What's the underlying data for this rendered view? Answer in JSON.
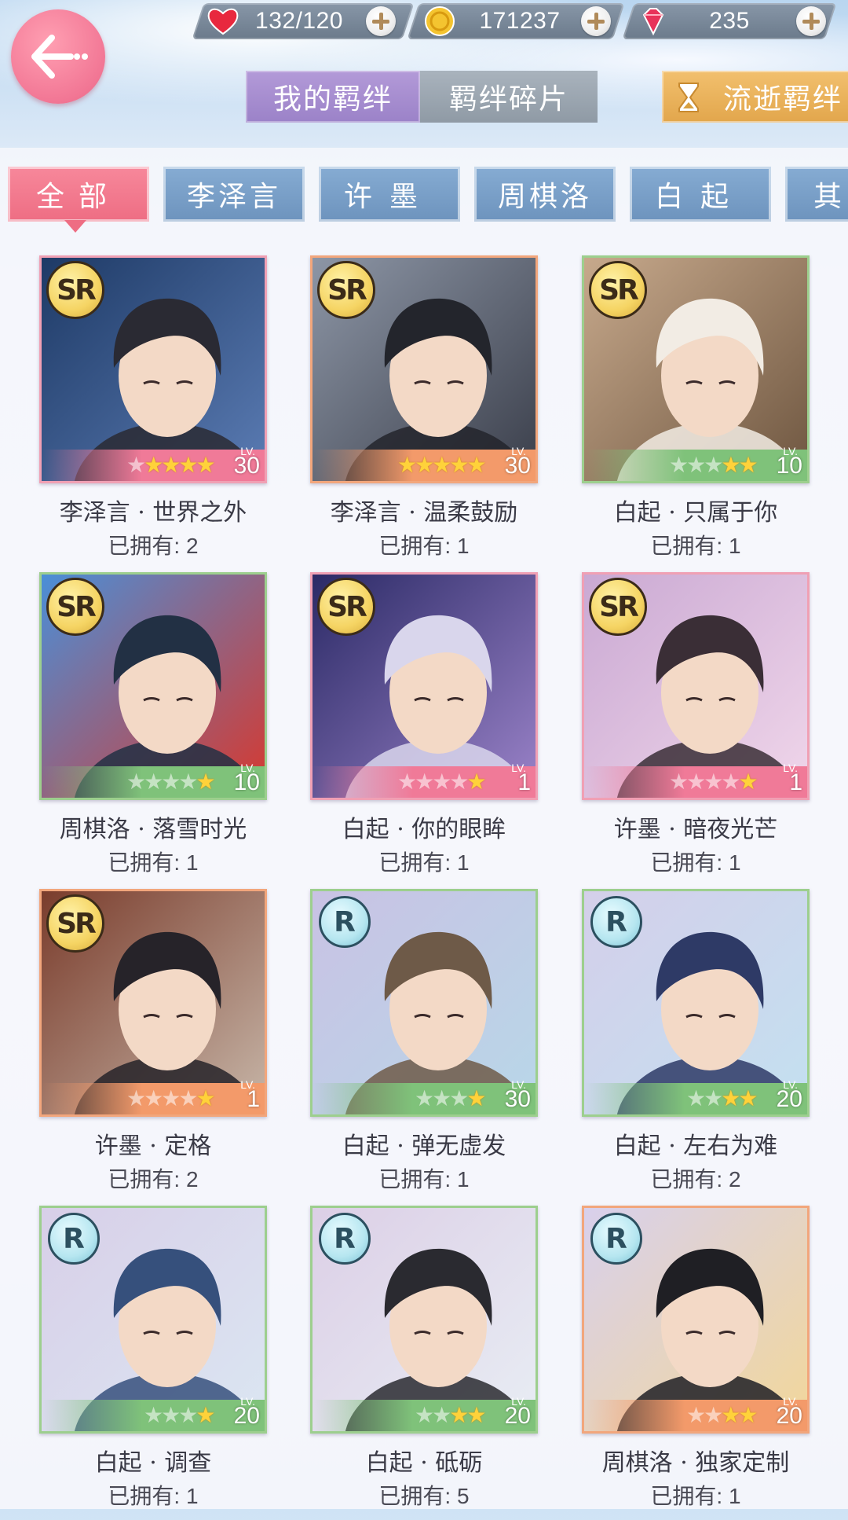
{
  "resources": {
    "stamina": {
      "icon": "heart-icon",
      "value": "132/120"
    },
    "gold": {
      "icon": "gold-coin-icon",
      "value": "171237"
    },
    "diamond": {
      "icon": "diamond-icon",
      "value": "235"
    }
  },
  "top_tabs": {
    "mine": "我的羁绊",
    "fragments": "羁绊碎片",
    "lapsed": "流逝羁绊"
  },
  "filters": [
    "全部",
    "李泽言",
    "许墨",
    "周棋洛",
    "白起",
    "其"
  ],
  "owned_label": "已拥有: ",
  "cards": [
    {
      "rarity": "SR",
      "name": "李泽言 · 世界之外",
      "owned": 2,
      "stars": 4,
      "max_stars": 5,
      "level": "30",
      "frame": "pink",
      "palette": [
        "#1e3a66",
        "#5b7cb4",
        "#2a2a33"
      ]
    },
    {
      "rarity": "SR",
      "name": "李泽言 · 温柔鼓励",
      "owned": 1,
      "stars": 5,
      "max_stars": 5,
      "level": "30",
      "frame": "orange",
      "palette": [
        "#8d96a6",
        "#3a3e4a",
        "#23252c"
      ]
    },
    {
      "rarity": "SR",
      "name": "白起 · 只属于你",
      "owned": 1,
      "stars": 2,
      "max_stars": 5,
      "level": "10",
      "frame": "green",
      "palette": [
        "#c7a98c",
        "#6e5640",
        "#f2ece4"
      ]
    },
    {
      "rarity": "SR",
      "name": "周棋洛 · 落雪时光",
      "owned": 1,
      "stars": 1,
      "max_stars": 5,
      "level": "10",
      "frame": "green",
      "palette": [
        "#4a8fd8",
        "#d8382e",
        "#223044"
      ]
    },
    {
      "rarity": "SR",
      "name": "白起 · 你的眼眸",
      "owned": 1,
      "stars": 1,
      "max_stars": 5,
      "level": "1",
      "frame": "pink",
      "palette": [
        "#2b2a66",
        "#9b83c9",
        "#d9d6ec"
      ]
    },
    {
      "rarity": "SR",
      "name": "许墨 · 暗夜光芒",
      "owned": 1,
      "stars": 1,
      "max_stars": 5,
      "level": "1",
      "frame": "pink",
      "palette": [
        "#caa9d3",
        "#f0d6ea",
        "#3a2e36"
      ]
    },
    {
      "rarity": "SR",
      "name": "许墨 · 定格",
      "owned": 2,
      "stars": 1,
      "max_stars": 5,
      "level": "1",
      "frame": "orange",
      "palette": [
        "#7a3c2c",
        "#c7b6a8",
        "#262329"
      ]
    },
    {
      "rarity": "R",
      "name": "白起 · 弹无虚发",
      "owned": 1,
      "stars": 1,
      "max_stars": 4,
      "level": "30",
      "frame": "green",
      "palette": [
        "#c9c2e4",
        "#b8d7e8",
        "#6e5a48"
      ]
    },
    {
      "rarity": "R",
      "name": "白起 · 左右为难",
      "owned": 2,
      "stars": 2,
      "max_stars": 4,
      "level": "20",
      "frame": "green",
      "palette": [
        "#d4cfea",
        "#c3e0f0",
        "#2e3a66"
      ]
    },
    {
      "rarity": "R",
      "name": "白起 · 调查",
      "owned": 1,
      "stars": 1,
      "max_stars": 4,
      "level": "20",
      "frame": "green",
      "palette": [
        "#d8cfe8",
        "#dbe6f2",
        "#36507c"
      ]
    },
    {
      "rarity": "R",
      "name": "白起 · 砥砺",
      "owned": 5,
      "stars": 2,
      "max_stars": 4,
      "level": "20",
      "frame": "green",
      "palette": [
        "#dccfe6",
        "#e8edf4",
        "#2a2a30"
      ]
    },
    {
      "rarity": "R",
      "name": "周棋洛 · 独家定制",
      "owned": 1,
      "stars": 2,
      "max_stars": 4,
      "level": "20",
      "frame": "orange",
      "palette": [
        "#d8d0ec",
        "#f2d79a",
        "#1f1f24"
      ]
    }
  ]
}
